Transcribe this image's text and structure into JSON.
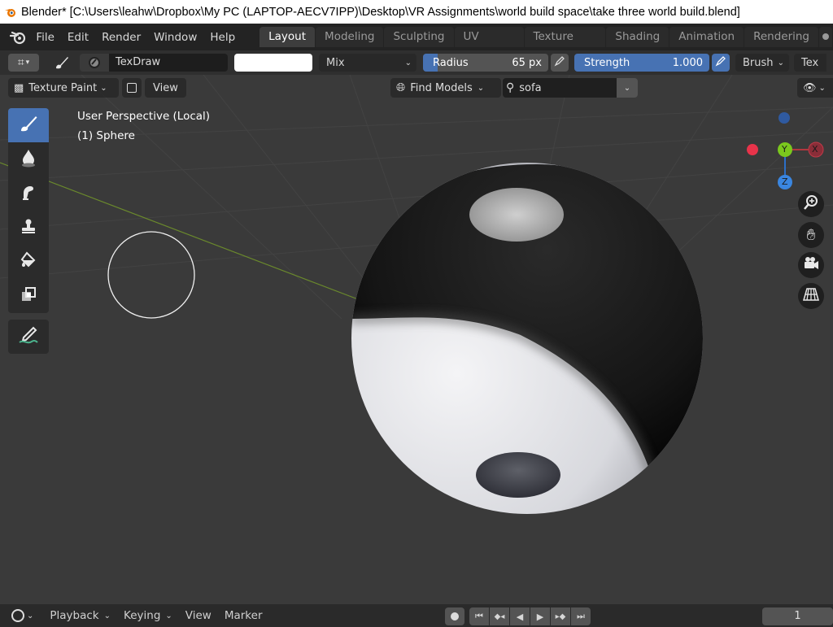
{
  "window": {
    "title": "Blender* [C:\\Users\\leahw\\Dropbox\\My PC (LAPTOP-AECV7IPP)\\Desktop\\VR Assignments\\world build space\\take three world build.blend]"
  },
  "menubar": {
    "items": [
      "File",
      "Edit",
      "Render",
      "Window",
      "Help"
    ],
    "tabs": [
      "Layout",
      "Modeling",
      "Sculpting",
      "UV Editing",
      "Texture Paint",
      "Shading",
      "Animation",
      "Rendering"
    ],
    "active_tab": "Layout"
  },
  "toolheader": {
    "brush_name": "TexDraw",
    "blend_mode": "Mix",
    "radius_label": "Radius",
    "radius_value": "65 px",
    "strength_label": "Strength",
    "strength_value": "1.000",
    "brush_menu": "Brush",
    "texture_menu": "Tex",
    "color": "#ffffff",
    "accent": "#4772b3"
  },
  "viewport": {
    "mode": "Texture Paint",
    "view_menu": "View",
    "find_models": "Find Models",
    "search_value": "sofa",
    "perspective_text": "User Perspective (Local)",
    "object_text": "(1) Sphere",
    "gizmo": {
      "x_label": "X",
      "y_label": "Y",
      "z_label": "Z"
    }
  },
  "tools": [
    "draw-brush",
    "soften-brush",
    "smear-brush",
    "clone-brush",
    "fill-brush",
    "mask-brush",
    "annotate"
  ],
  "timeline": {
    "items": [
      "Playback",
      "Keying",
      "View",
      "Marker"
    ],
    "current_frame": "1"
  }
}
